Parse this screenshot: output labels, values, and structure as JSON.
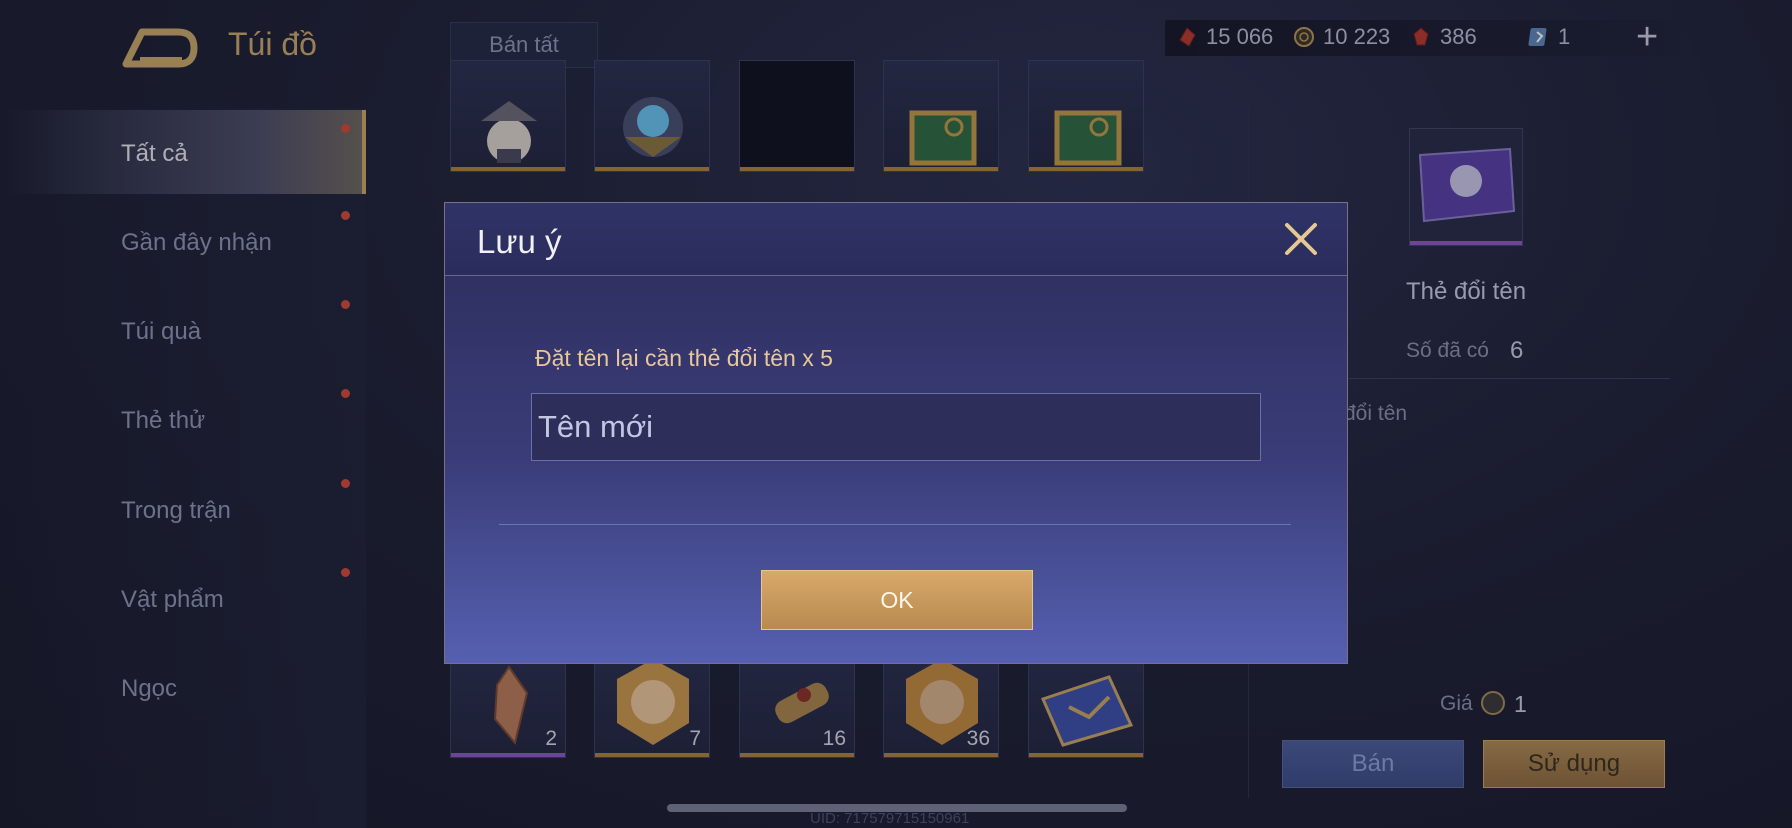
{
  "header": {
    "title": "Túi đồ",
    "sell_all_label": "Bán tất",
    "currencies": [
      {
        "icon": "red-shard-icon",
        "value": "15 066",
        "color": "#c0392b"
      },
      {
        "icon": "gold-coin-icon",
        "value": "10 223",
        "color": "#b8975a"
      },
      {
        "icon": "red-gem-icon",
        "value": "386",
        "color": "#c0392b"
      },
      {
        "icon": "blue-card-icon",
        "value": "1",
        "color": "#6fa8dc"
      }
    ],
    "add_label": "+"
  },
  "sidebar": {
    "items": [
      {
        "label": "Tất cả",
        "active": true
      },
      {
        "label": "Gần đây nhận"
      },
      {
        "label": "Túi quà"
      },
      {
        "label": "Thẻ thử"
      },
      {
        "label": "Trong trận"
      },
      {
        "label": "Vật phẩm"
      },
      {
        "label": "Ngọc"
      }
    ]
  },
  "grid": {
    "bottom_counts": [
      "2",
      "7",
      "16",
      "36"
    ]
  },
  "detail": {
    "item_name": "Thẻ đổi tên",
    "owned_label": "Số đã có",
    "owned_value": "6",
    "description": "đổi tên",
    "price_label": "Giá",
    "price_value": "1",
    "sell_label": "Bán",
    "use_label": "Sử dụng"
  },
  "footer": {
    "uid": "UID: 717579715150961"
  },
  "modal": {
    "title": "Lưu ý",
    "message": "Đặt tên lại cần thẻ đổi tên x 5",
    "input_placeholder": "Tên mới",
    "input_value": "",
    "ok_label": "OK"
  }
}
